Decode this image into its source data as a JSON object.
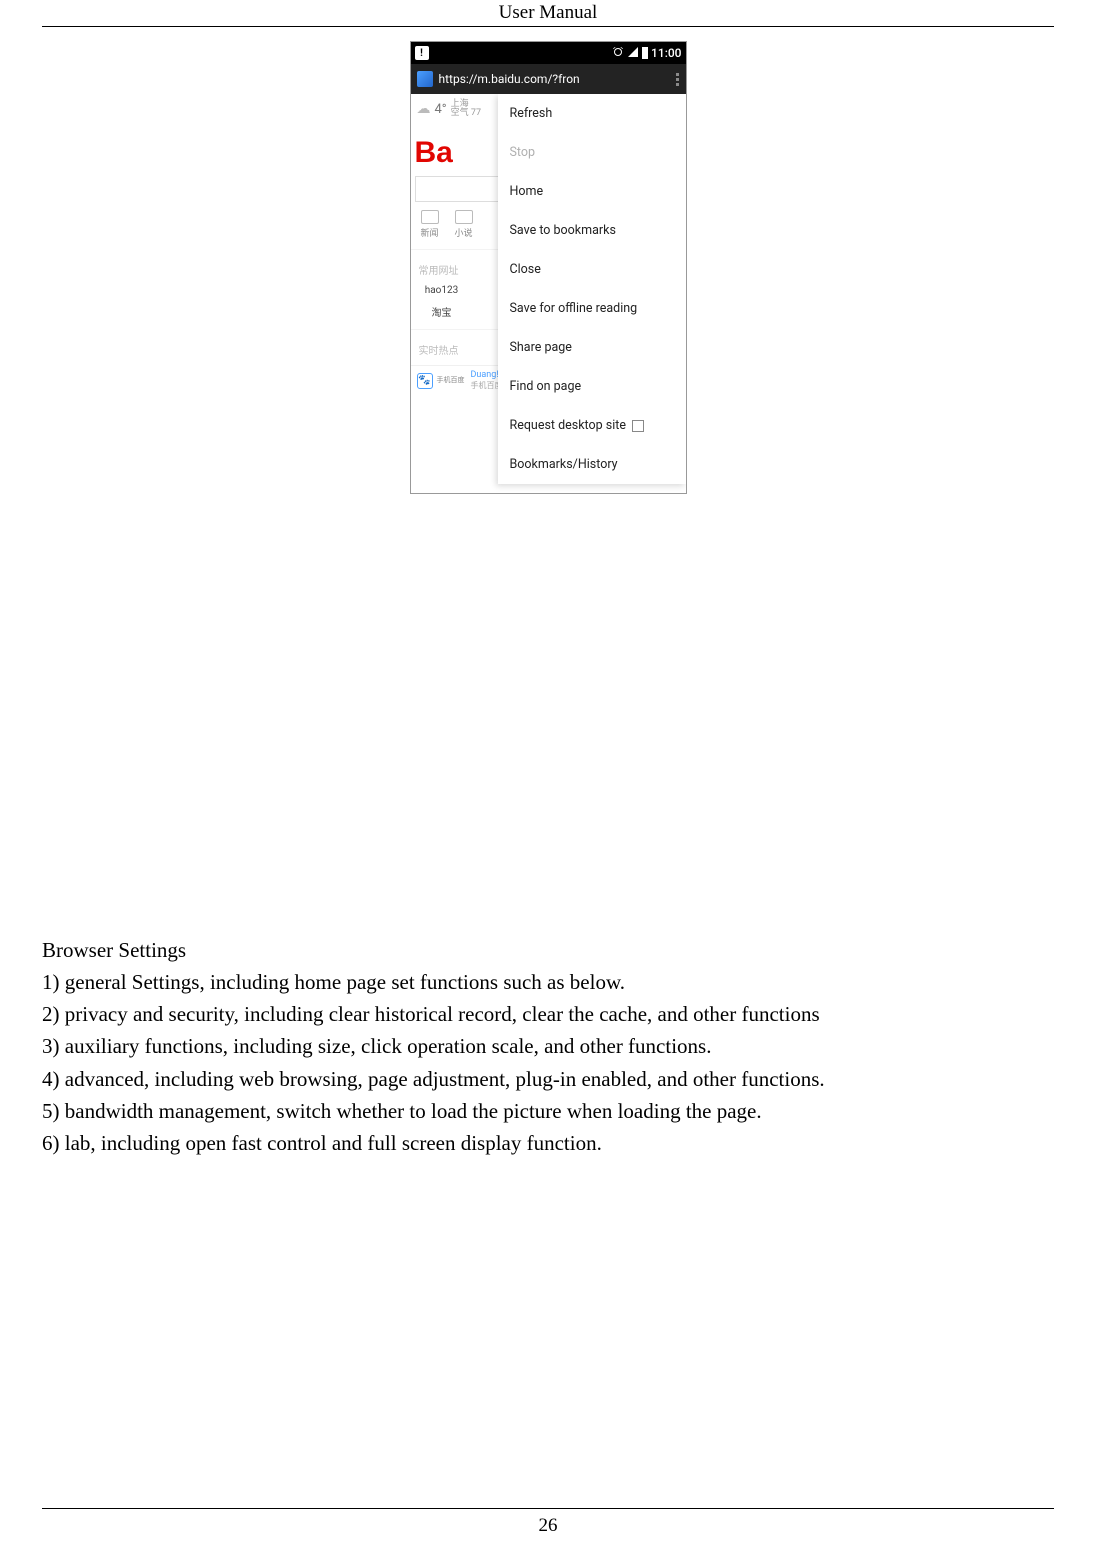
{
  "header": {
    "title": "User  Manual"
  },
  "page_number": "26",
  "phone": {
    "status": {
      "notif": "!",
      "time": "11:00"
    },
    "url": "https://m.baidu.com/?fron",
    "page": {
      "temp": "4°",
      "city": "上海",
      "air_label": "空气",
      "air_value": "77",
      "logo_fragment": "Ba",
      "tabs": {
        "news": "新闻",
        "novel": "小说"
      },
      "section_common": "常用网址",
      "links": {
        "hao123": "hao123",
        "taobao": "淘宝"
      },
      "section_hot": "实时热点",
      "promo": {
        "line1": "Duang!",
        "line2": "手机百度",
        "caption": "手机百度"
      }
    },
    "menu": {
      "refresh": "Refresh",
      "stop": "Stop",
      "home": "Home",
      "save_bookmarks": "Save to bookmarks",
      "close": "Close",
      "save_offline": "Save for offline reading",
      "share": "Share page",
      "find": "Find on page",
      "desktop_site": "Request desktop site",
      "bookmarks_history": "Bookmarks/History"
    }
  },
  "content": {
    "heading": "Browser Settings",
    "items": [
      "1) general Settings, including home page set functions such as below.",
      "2) privacy and security, including clear historical record, clear the cache, and other functions",
      "3) auxiliary functions, including size, click operation scale, and other functions.",
      "4) advanced, including web browsing, page adjustment, plug-in enabled, and other functions.",
      "5) bandwidth management, switch whether to load the picture when loading the page.",
      "6) lab, including open fast control and full screen display function."
    ]
  }
}
